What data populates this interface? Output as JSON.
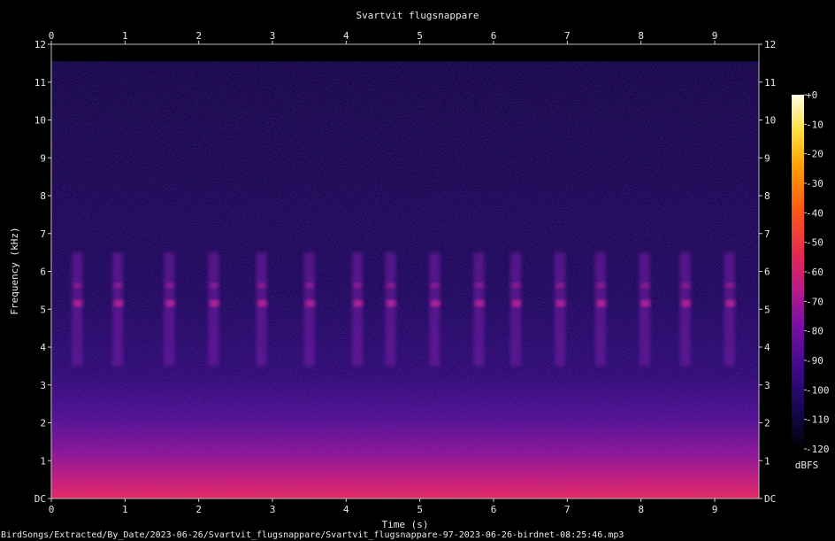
{
  "chart_data": {
    "type": "heatmap",
    "title": "Svartvit flugsnappare",
    "xlabel": "Time (s)",
    "ylabel": "Frequency (kHz)",
    "xlim": [
      0,
      9.6
    ],
    "ylim": [
      0,
      12
    ],
    "x_ticks": [
      0,
      1,
      2,
      3,
      4,
      5,
      6,
      7,
      8,
      9
    ],
    "x_tick_labels": [
      "0",
      "1",
      "2",
      "3",
      "4",
      "5",
      "6",
      "7",
      "8",
      "9"
    ],
    "y_ticks": [
      0,
      1,
      2,
      3,
      4,
      5,
      6,
      7,
      8,
      9,
      10,
      11,
      12
    ],
    "y_tick_labels": [
      "DC",
      "1",
      "2",
      "3",
      "4",
      "5",
      "6",
      "7",
      "8",
      "9",
      "10",
      "11",
      "12"
    ],
    "colorbar": {
      "label": "dBFS",
      "range": [
        -120,
        0
      ],
      "ticks": [
        0,
        -10,
        -20,
        -30,
        -40,
        -50,
        -60,
        -70,
        -80,
        -90,
        -100,
        -110,
        -120
      ],
      "tick_labels": [
        "+0",
        "-10",
        "-20",
        "-30",
        "-40",
        "-50",
        "-60",
        "-70",
        "-80",
        "-90",
        "-100",
        "-110",
        "-120"
      ],
      "colormap": [
        "#000000",
        "#14084a",
        "#3a0a8a",
        "#7a0ea6",
        "#b81a8a",
        "#e62850",
        "#ff5a14",
        "#ffa000",
        "#ffe040",
        "#ffffe6"
      ]
    },
    "grid": false,
    "notes": {
      "song_phrases_at_s": [
        0.35,
        0.9,
        1.6,
        2.2,
        2.85,
        3.5,
        4.15,
        4.6,
        5.2,
        5.8,
        6.3,
        6.9,
        7.45,
        8.05,
        8.6,
        9.2
      ],
      "main_energy_band_khz": [
        3.5,
        6.5
      ],
      "low_frequency_noise_khz": [
        0,
        1.5
      ]
    }
  },
  "footer": {
    "filename": "BirdSongs/Extracted/By_Date/2023-06-26/Svartvit_flugsnappare/Svartvit_flugsnappare-97-2023-06-26-birdnet-08:25:46.mp3"
  }
}
